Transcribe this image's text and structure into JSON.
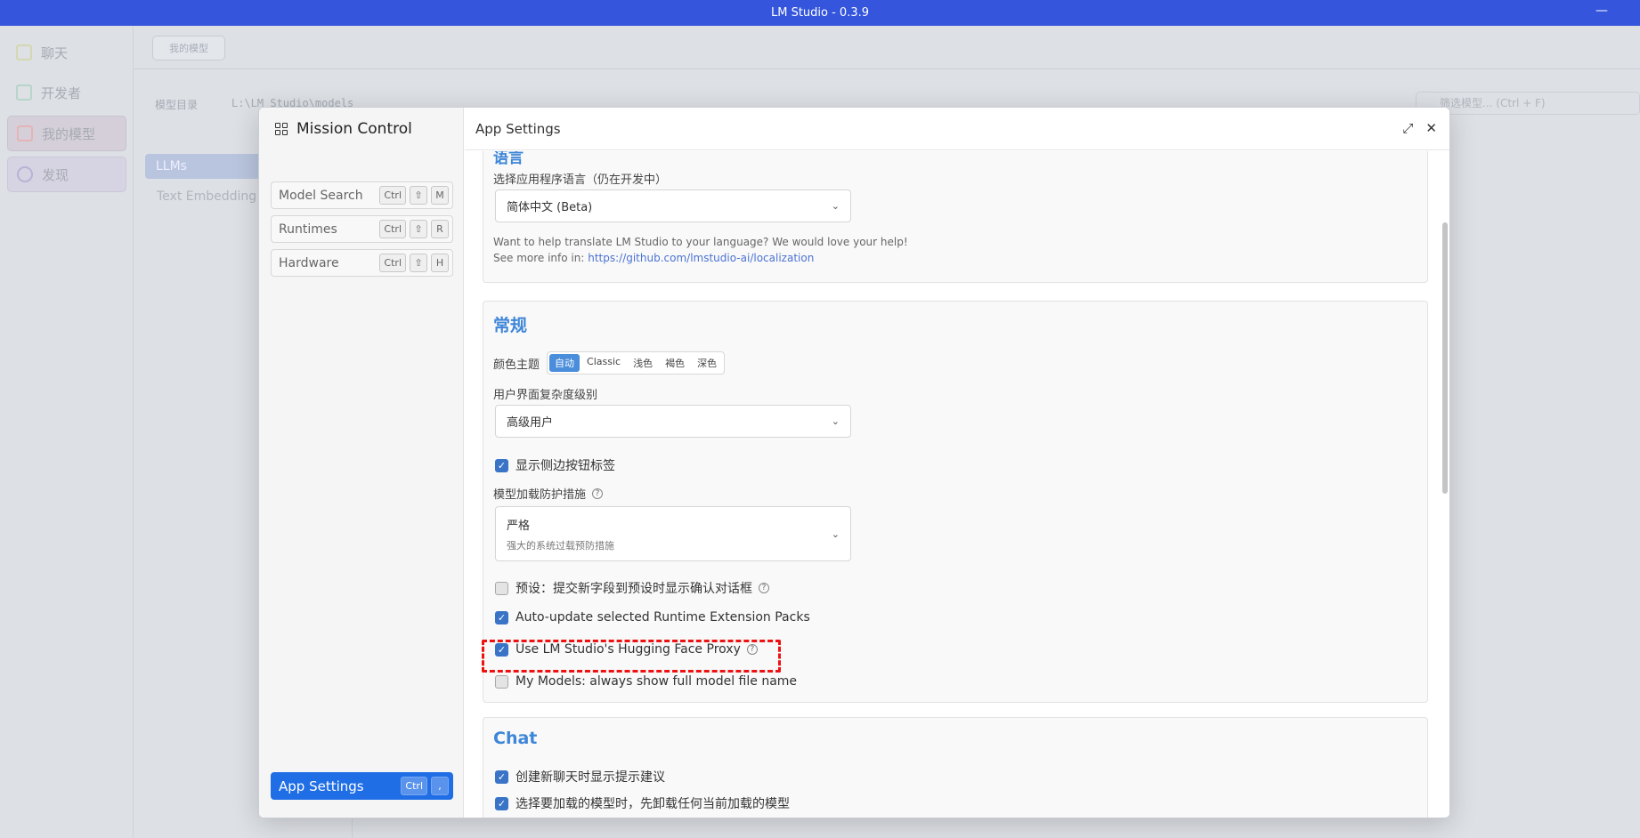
{
  "window": {
    "title": "LM Studio - 0.3.9",
    "minimize": "—"
  },
  "nav": {
    "items": [
      {
        "label": "聊天",
        "icon": "chat-bubble-icon"
      },
      {
        "label": "开发者",
        "icon": "terminal-icon"
      },
      {
        "label": "我的模型",
        "icon": "folder-icon"
      },
      {
        "label": "发现",
        "icon": "search-icon"
      }
    ]
  },
  "background": {
    "pill": "我的模型",
    "dir_label": "模型目录",
    "dir_path": "L:\\LM Studio\\models",
    "search_placeholder": "筛选模型... (Ctrl + F)",
    "llms": "LLMs",
    "text_embedding": "Text Embedding"
  },
  "sidebar": {
    "title": "Mission Control",
    "items": [
      {
        "label": "Model Search",
        "keys": [
          "Ctrl",
          "⇧",
          "M"
        ]
      },
      {
        "label": "Runtimes",
        "keys": [
          "Ctrl",
          "⇧",
          "R"
        ]
      },
      {
        "label": "Hardware",
        "keys": [
          "Ctrl",
          "⇧",
          "H"
        ]
      }
    ],
    "active": {
      "label": "App Settings",
      "keys": [
        "Ctrl",
        ","
      ]
    }
  },
  "header": {
    "title": "App Settings",
    "expand_icon": "⤢",
    "close_icon": "✕"
  },
  "language": {
    "heading": "语言",
    "label": "选择应用程序语言（仍在开发中）",
    "value": "简体中文 (Beta)",
    "note1": "Want to help translate LM Studio to your language? We would love your help!",
    "note2_prefix": "See more info in: ",
    "link": "https://github.com/lmstudio-ai/localization"
  },
  "general": {
    "heading": "常规",
    "theme_label": "颜色主题",
    "theme_options": [
      "自动",
      "Classic",
      "浅色",
      "褐色",
      "深色"
    ],
    "complexity_label": "用户界面复杂度级别",
    "complexity_value": "高级用户",
    "show_sidebar_labels": "显示侧边按钮标签",
    "guardrails_label": "模型加载防护措施",
    "guardrails_value": "严格",
    "guardrails_desc": "强大的系统过载预防措施",
    "preset_confirm": "预设：提交新字段到预设时显示确认对话框",
    "auto_update": "Auto-update selected Runtime Extension Packs",
    "hf_proxy": "Use LM Studio's Hugging Face Proxy",
    "full_name": "My Models: always show full model file name"
  },
  "chat": {
    "heading": "Chat",
    "suggest": "创建新聊天时显示提示建议",
    "unload": "选择要加载的模型时，先卸载任何当前加载的模型"
  }
}
